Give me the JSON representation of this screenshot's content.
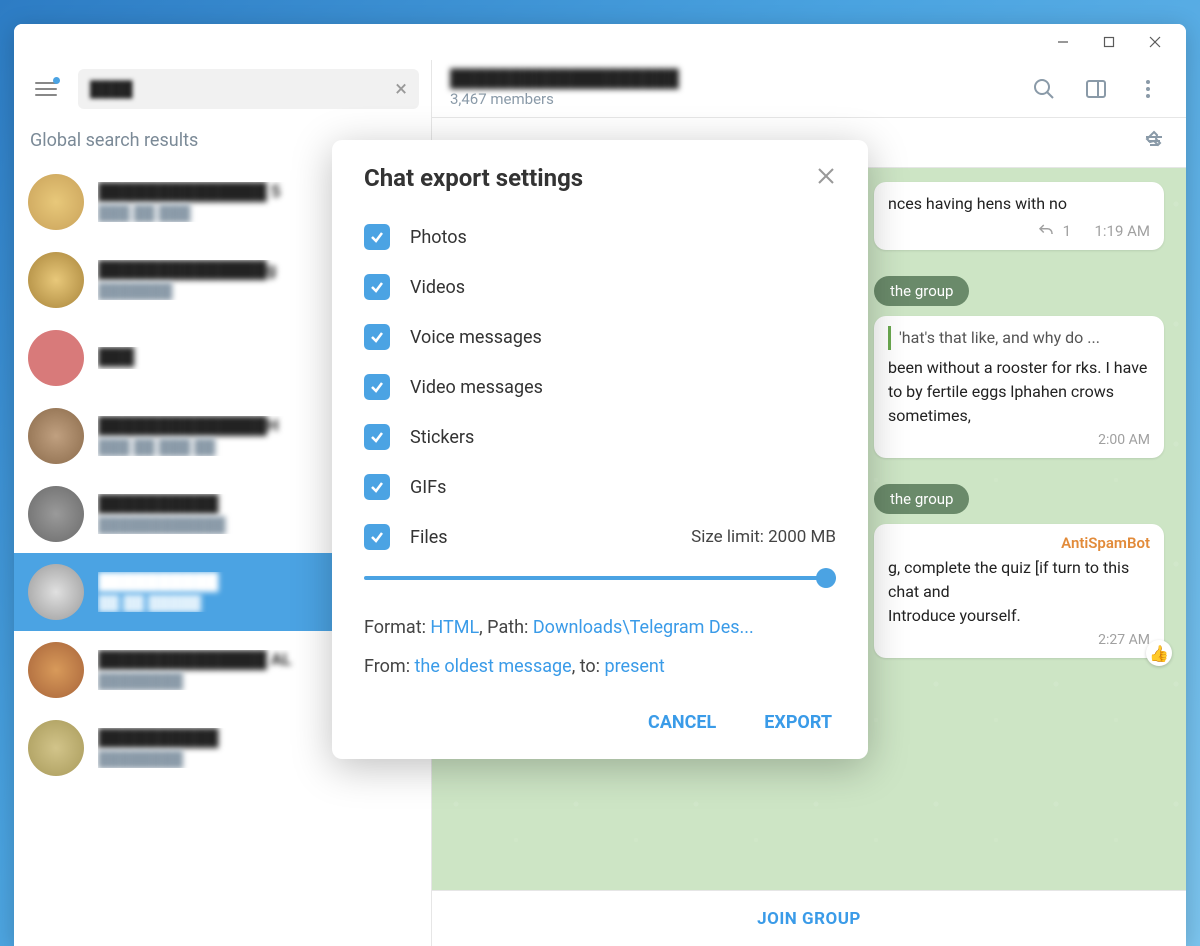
{
  "titlebar": {
    "minimize": "—",
    "maximize": "▢",
    "close": "×"
  },
  "sidebar": {
    "section_label": "Global search results",
    "search_value": "████",
    "chats": [
      {
        "name": "██████████████ 5",
        "sub": "███ ██ ███"
      },
      {
        "name": "██████████████g",
        "sub": "███████"
      },
      {
        "name": "███",
        "sub": ""
      },
      {
        "name": "██████████████H",
        "sub": "███ ██ ███ ██"
      },
      {
        "name": "██████████",
        "sub": "████████████"
      },
      {
        "name": "██████████",
        "sub": "██ ██ █████"
      },
      {
        "name": "██████████████ AL",
        "sub": "████████"
      },
      {
        "name": "██████████",
        "sub": "████████"
      }
    ]
  },
  "chat_header": {
    "title": "███████████████████",
    "members": "3,467 members"
  },
  "messages": {
    "snippet1": "nces having hens with no",
    "reply_count": "1",
    "time1": "1:19 AM",
    "service1": "the group",
    "snippet2a": "'hat's that like, and why do ...",
    "snippet2b": "been without a rooster for rks. I have to by fertile eggs lphahen crows sometimes,",
    "time2": "2:00 AM",
    "service2": "the group",
    "sender3": "AntiSpamBot",
    "snippet3": "g, complete the quiz [if turn to this chat and",
    "snippet3b": "Introduce yourself.",
    "time3": "2:27 AM",
    "react": "👍"
  },
  "bottom": {
    "join": "JOIN GROUP"
  },
  "modal": {
    "title": "Chat export settings",
    "options": {
      "photos": "Photos",
      "videos": "Videos",
      "voice": "Voice messages",
      "videomsg": "Video messages",
      "stickers": "Stickers",
      "gifs": "GIFs",
      "files": "Files"
    },
    "size_limit": "Size limit: 2000 MB",
    "format_label": "Format: ",
    "format_value": "HTML",
    "path_label": ", Path: ",
    "path_value": "Downloads\\Telegram Des...",
    "from_label": "From: ",
    "from_value": "the oldest message",
    "to_label": ", to: ",
    "to_value": "present",
    "cancel": "CANCEL",
    "export": "EXPORT"
  }
}
